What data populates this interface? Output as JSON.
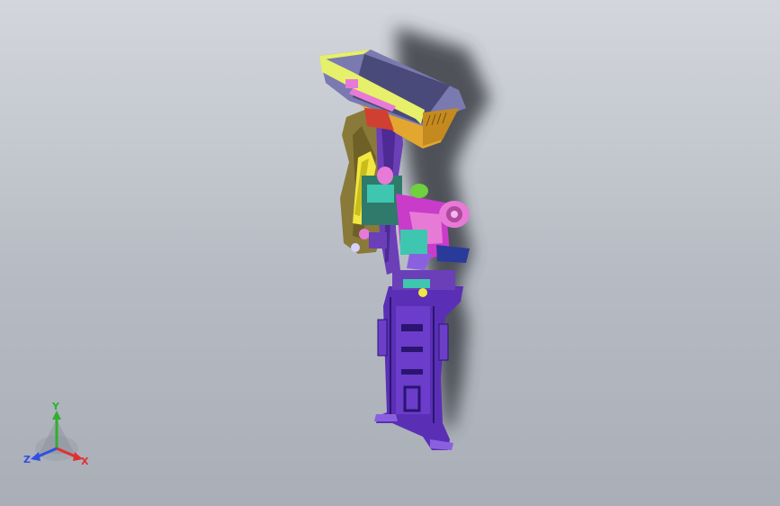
{
  "viewport": {
    "background_top": "#d3d6dc",
    "background_bottom": "#a9aeb7"
  },
  "model": {
    "part_colors": {
      "bucket": "#e6f06a",
      "bucket_under": "#e3a72f",
      "arm": "#6a3fb8",
      "boom_plate": "#8a7a3a",
      "frame": "#5a2fb5",
      "pink_parts": "#e77ad6",
      "cylinder": "#f2e640",
      "teal": "#3ec6b0",
      "magenta": "#c93cc9",
      "shadow": "#3a3d44"
    }
  },
  "triad": {
    "x_label": "X",
    "y_label": "Y",
    "z_label": "Z",
    "x_color": "#e03030",
    "y_color": "#30b030",
    "z_color": "#3050e0"
  }
}
